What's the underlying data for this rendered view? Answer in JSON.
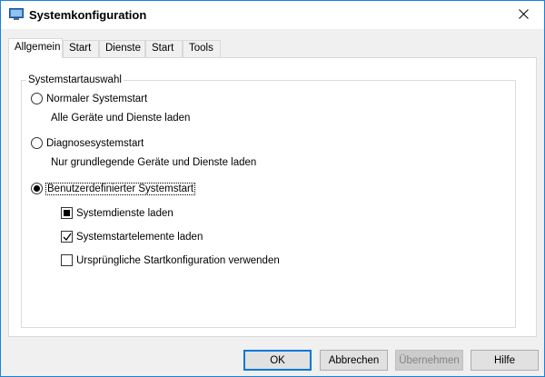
{
  "window": {
    "title": "Systemkonfiguration",
    "app_icon": "msconfig-icon",
    "close_icon": "close-icon"
  },
  "tabs": [
    {
      "label": "Allgemein",
      "active": true
    },
    {
      "label": "Start",
      "active": false
    },
    {
      "label": "Dienste",
      "active": false
    },
    {
      "label": "Start",
      "active": false
    },
    {
      "label": "Tools",
      "active": false
    }
  ],
  "group": {
    "title": "Systemstartauswahl",
    "options": [
      {
        "label": "Normaler Systemstart",
        "description": "Alle Geräte und Dienste laden",
        "checked": false
      },
      {
        "label": "Diagnosesystemstart",
        "description": "Nur grundlegende Geräte und Dienste laden",
        "checked": false
      },
      {
        "label": "Benutzerdefinierter Systemstart",
        "checked": true
      }
    ],
    "checkboxes": [
      {
        "label": "Systemdienste laden",
        "state": "indeterminate"
      },
      {
        "label": "Systemstartelemente laden",
        "state": "checked"
      },
      {
        "label": "Ursprüngliche Startkonfiguration verwenden",
        "state": "unchecked"
      }
    ]
  },
  "buttons": {
    "ok": "OK",
    "cancel": "Abbrechen",
    "apply": "Übernehmen",
    "help": "Hilfe"
  },
  "colors": {
    "accent": "#0078d7",
    "window_border": "#1883d7",
    "dialog_bg": "#f0f0f0",
    "panel_bg": "#ffffff"
  }
}
